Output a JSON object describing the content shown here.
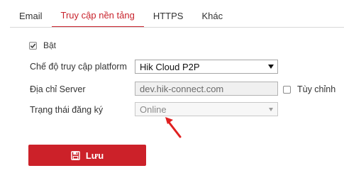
{
  "tabs": [
    {
      "label": "Email"
    },
    {
      "label": "Truy cập nền tảng"
    },
    {
      "label": "HTTPS"
    },
    {
      "label": "Khác"
    }
  ],
  "active_tab": "Truy cập nền tảng",
  "enable": {
    "label": "Bật",
    "checked": true
  },
  "form": {
    "mode_label": "Chế độ truy cập platform",
    "mode_value": "Hik Cloud P2P",
    "server_label": "Địa chỉ Server",
    "server_value": "dev.hik-connect.com",
    "custom_label": "Tùy chỉnh",
    "custom_checked": false,
    "status_label": "Trạng thái đăng ký",
    "status_value": "Online"
  },
  "save_label": "Lưu",
  "colors": {
    "accent": "#c8232c",
    "button": "#cc2129",
    "annotation_arrow": "#e02020"
  },
  "icons": {
    "enable_check": "checkmark-icon",
    "mode_dropdown": "chevron-down-icon",
    "status_dropdown": "chevron-down-icon",
    "save": "save-icon",
    "annotation": "arrow-annotation-icon"
  }
}
